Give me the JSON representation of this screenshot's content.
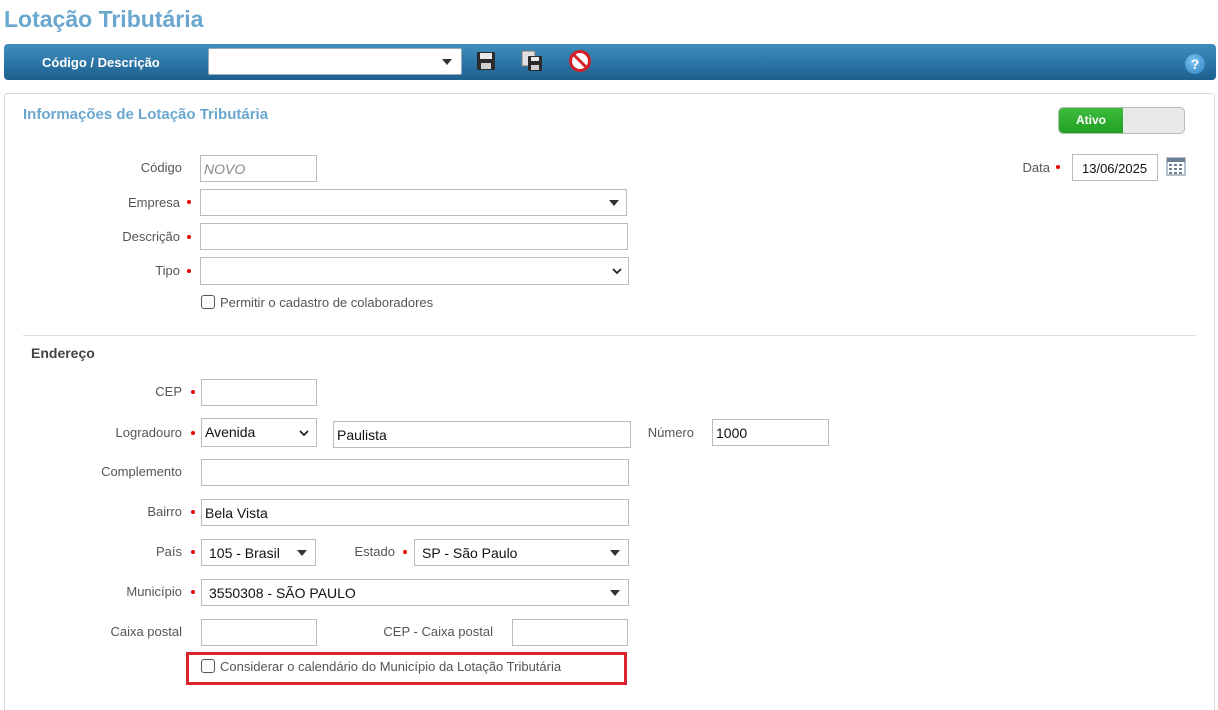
{
  "page": {
    "title": "Lotação Tributária"
  },
  "toolbar": {
    "label": "Código / Descrição",
    "select_value": "",
    "icons": [
      "save-icon",
      "save-as-icon",
      "cancel-icon",
      "help-icon"
    ],
    "help_glyph": "?"
  },
  "form": {
    "section_title": "Informações de Lotação Tributária",
    "status_toggle": {
      "label": "Ativo",
      "on": true,
      "on_color": "#2aa52a"
    },
    "codigo": {
      "label": "Código",
      "placeholder": "NOVO"
    },
    "data": {
      "label": "Data",
      "value": "13/06/2025"
    },
    "empresa": {
      "label": "Empresa",
      "value": ""
    },
    "descricao": {
      "label": "Descrição",
      "value": ""
    },
    "tipo": {
      "label": "Tipo",
      "value": ""
    },
    "permitir_cadastro": {
      "label": "Permitir o cadastro de colaboradores",
      "checked": false
    }
  },
  "endereco": {
    "title": "Endereço",
    "cep": {
      "label": "CEP",
      "value": ""
    },
    "logradouro": {
      "label": "Logradouro",
      "tipo": "Avenida",
      "value": "Paulista"
    },
    "numero": {
      "label": "Número",
      "value": "1000"
    },
    "complemento": {
      "label": "Complemento",
      "value": ""
    },
    "bairro": {
      "label": "Bairro",
      "value": "Bela Vista"
    },
    "pais": {
      "label": "País",
      "value": "105 - Brasil"
    },
    "estado": {
      "label": "Estado",
      "value": "SP - São Paulo"
    },
    "municipio": {
      "label": "Município",
      "value": "3550308 - SÃO PAULO"
    },
    "caixa_postal": {
      "label": "Caixa postal",
      "value": ""
    },
    "cep_caixa_postal": {
      "label": "CEP - Caixa postal",
      "value": ""
    },
    "considerar_calendario": {
      "label": "Considerar o calendário do Município da Lotação Tributária",
      "checked": false
    }
  },
  "colors": {
    "title": "#6aa7cf",
    "toolbar": "#2a6f9e",
    "required": "#e60000",
    "highlight": "#d9232d"
  }
}
